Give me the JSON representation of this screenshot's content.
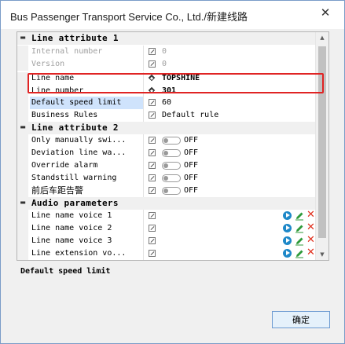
{
  "window": {
    "title": "Bus Passenger Transport Service Co., Ltd./新建线路",
    "close_glyph": "✕"
  },
  "grid": {
    "categories": {
      "line_attr_1": "Line attribute 1",
      "line_attr_2": "Line attribute 2",
      "audio": "Audio parameters"
    },
    "collapse_glyph": "▬",
    "rows": {
      "internal_number": {
        "name": "Internal number",
        "value": "0"
      },
      "version": {
        "name": "Version",
        "value": "0"
      },
      "line_name": {
        "name": "Line name",
        "value": "TOPSHINE"
      },
      "line_number": {
        "name": "Line number",
        "value": "301"
      },
      "default_speed": {
        "name": "Default speed limit",
        "value": "60"
      },
      "business_rules": {
        "name": "Business Rules",
        "value": "Default rule"
      },
      "only_manually": {
        "name": "Only manually swi...",
        "value": "OFF"
      },
      "deviation": {
        "name": "Deviation line wa...",
        "value": "OFF"
      },
      "override": {
        "name": "Override alarm",
        "value": "OFF"
      },
      "standstill": {
        "name": "Standstill warning",
        "value": "OFF"
      },
      "headway": {
        "name": "前后车距告警",
        "value": "OFF"
      },
      "voice1": {
        "name": "Line name voice 1"
      },
      "voice2": {
        "name": "Line name voice 2"
      },
      "voice3": {
        "name": "Line name voice 3"
      },
      "ext_voice": {
        "name": "Line extension vo..."
      }
    },
    "delete_glyph": "✕"
  },
  "description": {
    "title": "Default speed limit"
  },
  "footer": {
    "ok_label": "确定"
  },
  "scrollbar": {
    "up_glyph": "▲",
    "down_glyph": "▼"
  },
  "colors": {
    "selection": "#cfe3fc",
    "highlight": "#e02424",
    "play": "#1e88c8",
    "edit": "#2e9a3a",
    "delete": "#e0301e"
  }
}
